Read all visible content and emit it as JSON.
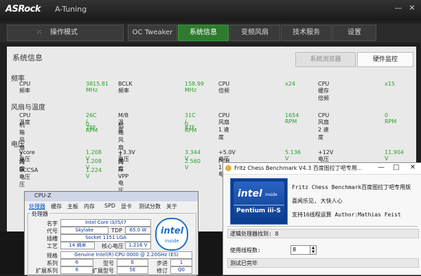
{
  "app": {
    "logo": "ASRock",
    "title": "A-Tuning",
    "minimize": "—",
    "close": "✕"
  },
  "nav": {
    "mode_button": "操作模式",
    "mode_icon": "dots-grid-icon",
    "tabs": [
      {
        "label": "OC Tweaker",
        "active": false
      },
      {
        "label": "系统信息",
        "active": true
      },
      {
        "label": "变频风扇",
        "active": false
      },
      {
        "label": "技术服务",
        "active": false
      },
      {
        "label": "设置",
        "active": false
      }
    ]
  },
  "panel": {
    "title": "系统信息",
    "subtabs": [
      "系统浏览器",
      "硬件监控"
    ],
    "sections": {
      "freq": "频率",
      "fan_temp": "风扇与温度",
      "voltage": "电压"
    },
    "freq_rows": [
      {
        "l1": "CPU 频率",
        "v1": "3815.81 MHz",
        "l2": "BCLK 频率",
        "v2": "158.99 MHz",
        "l3": "CPU 倍频",
        "v3": "x24",
        "l4": "CPU 缓存倍频",
        "v4": "x15"
      }
    ],
    "temp_rows": [
      {
        "l1": "CPU 温度",
        "v1": "26C / 78F",
        "l2": "M/B 温度",
        "v2": "31C / 87F",
        "l3": "CPU 风扇 1 速度",
        "v3": "1654 RPM",
        "l4": "CPU 风扇 2 速度",
        "v4": "0 RPM"
      },
      {
        "l1": "机箱风扇 2 速度",
        "v1": "0 RPM",
        "l2": "机箱风扇 3 速度",
        "v2": "0 RPM",
        "l3": "",
        "v3": "",
        "l4": "",
        "v4": ""
      }
    ],
    "volt_rows": [
      {
        "l1": "Vcore 电压",
        "v1": "1.208 V",
        "l2": "+3.3V 电压",
        "v2": "3.344 V",
        "l3": "+5.0V 电压",
        "v3": "5.136 V",
        "l4": "+12V 电压",
        "v4": "11.904 V"
      },
      {
        "l1": "内存电压",
        "v1": "1.208 V",
        "l2": "内存 VPP 电压",
        "v2": "2.560 V",
        "l3": "PCH 1.0V 电压",
        "v3": "",
        "l4": "",
        "v4": ""
      },
      {
        "l1": "VCCSA 电压",
        "v1": "1.224 V",
        "l2": "",
        "v2": "",
        "l3": "",
        "v3": "",
        "l4": "",
        "v4": ""
      }
    ]
  },
  "cpuz": {
    "title": "CPU-Z",
    "tabs": [
      "处理器",
      "缓存",
      "主板",
      "内存",
      "SPD",
      "显卡",
      "测试分数",
      "关于"
    ],
    "group": "处理器",
    "fields": {
      "name_l": "名字",
      "name_v": "Intel Core i3/i5/i7",
      "code_l": "代号",
      "code_v": "Skylake",
      "tdp_l": "TDP",
      "tdp_v": "65.0 W",
      "pkg_l": "插槽",
      "pkg_v": "Socket 1151 LGA",
      "tech_l": "工艺",
      "tech_v": "14 纳米",
      "volt_l": "核心电压",
      "volt_v": "1.216 V",
      "spec_l": "规格",
      "spec_v": "Genuine Intel(R) CPU 0000 @ 2.20GHz (ES)",
      "fam_l": "系列",
      "fam_v": "6",
      "model_l": "型号",
      "model_v": "E",
      "step_l": "步进",
      "step_v": "1",
      "efam_l": "扩展系列",
      "efam_v": "6",
      "emodel_l": "扩展型号",
      "emodel_v": "5E",
      "rev_l": "修订",
      "rev_v": "Q0"
    },
    "logo_word": "intel",
    "logo_sub": "inside"
  },
  "fritz": {
    "title": "Fritz Chess Benchmark V4.3 百度图拉丁吧专用...",
    "info1": "Fritz Chess Benchmark百度图拉丁吧专用版",
    "info2": "喜闻乐见, 大快人心",
    "info3": "支持16线程运算   Author:Mathias Feist",
    "status1": "逻辑处理器找到: 8",
    "threads_label": "使用线程数:",
    "threads_value": "8",
    "status2": "测试已完毕",
    "logo_word": "intel",
    "logo_inside": "inside",
    "logo_product": "Pentium iii-S"
  }
}
